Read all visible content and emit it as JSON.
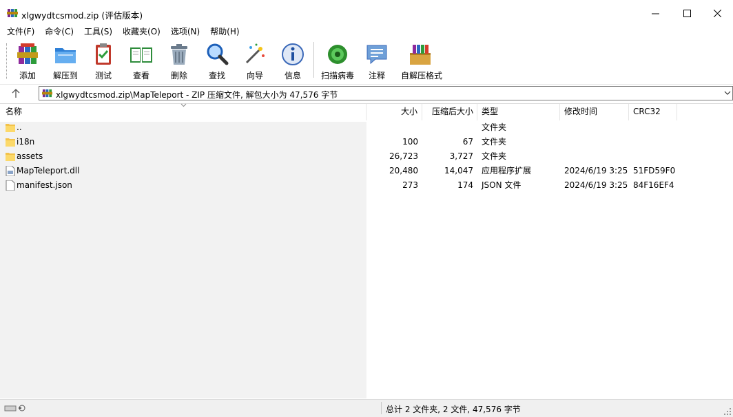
{
  "window": {
    "title": "xlgwydtcsmod.zip (评估版本)",
    "accent": "#1f3f9a"
  },
  "menu": [
    "文件(F)",
    "命令(C)",
    "工具(S)",
    "收藏夹(O)",
    "选项(N)",
    "帮助(H)"
  ],
  "toolbar": [
    {
      "label": "添加",
      "icon": "add-archive-icon"
    },
    {
      "label": "解压到",
      "icon": "extract-folder-icon"
    },
    {
      "label": "测试",
      "icon": "test-clipboard-icon"
    },
    {
      "label": "查看",
      "icon": "view-book-icon"
    },
    {
      "label": "删除",
      "icon": "trash-icon"
    },
    {
      "label": "查找",
      "icon": "magnifier-icon"
    },
    {
      "label": "向导",
      "icon": "wizard-wand-icon"
    },
    {
      "label": "信息",
      "icon": "info-icon"
    },
    {
      "label": "扫描病毒",
      "icon": "virus-scan-icon"
    },
    {
      "label": "注释",
      "icon": "comment-icon"
    },
    {
      "label": "自解压格式",
      "icon": "sfx-archive-icon"
    }
  ],
  "address": {
    "path": "xlgwydtcsmod.zip\\MapTeleport - ZIP 压缩文件, 解包大小为 47,576 字节"
  },
  "columns": {
    "name": "名称",
    "size": "大小",
    "packed": "压缩后大小",
    "type": "类型",
    "modified": "修改时间",
    "crc": "CRC32"
  },
  "files": [
    {
      "name": "..",
      "size": "",
      "packed": "",
      "type": "文件夹",
      "modified": "",
      "crc": "",
      "kind": "folder"
    },
    {
      "name": "i18n",
      "size": "100",
      "packed": "67",
      "type": "文件夹",
      "modified": "",
      "crc": "",
      "kind": "folder"
    },
    {
      "name": "assets",
      "size": "26,723",
      "packed": "3,727",
      "type": "文件夹",
      "modified": "",
      "crc": "",
      "kind": "folder"
    },
    {
      "name": "MapTeleport.dll",
      "size": "20,480",
      "packed": "14,047",
      "type": "应用程序扩展",
      "modified": "2024/6/19 3:25",
      "crc": "51FD59F0",
      "kind": "dll"
    },
    {
      "name": "manifest.json",
      "size": "273",
      "packed": "174",
      "type": "JSON 文件",
      "modified": "2024/6/19 3:25",
      "crc": "84F16EF4",
      "kind": "file"
    }
  ],
  "status": {
    "summary": "总计 2 文件夹, 2 文件, 47,576 字节"
  }
}
